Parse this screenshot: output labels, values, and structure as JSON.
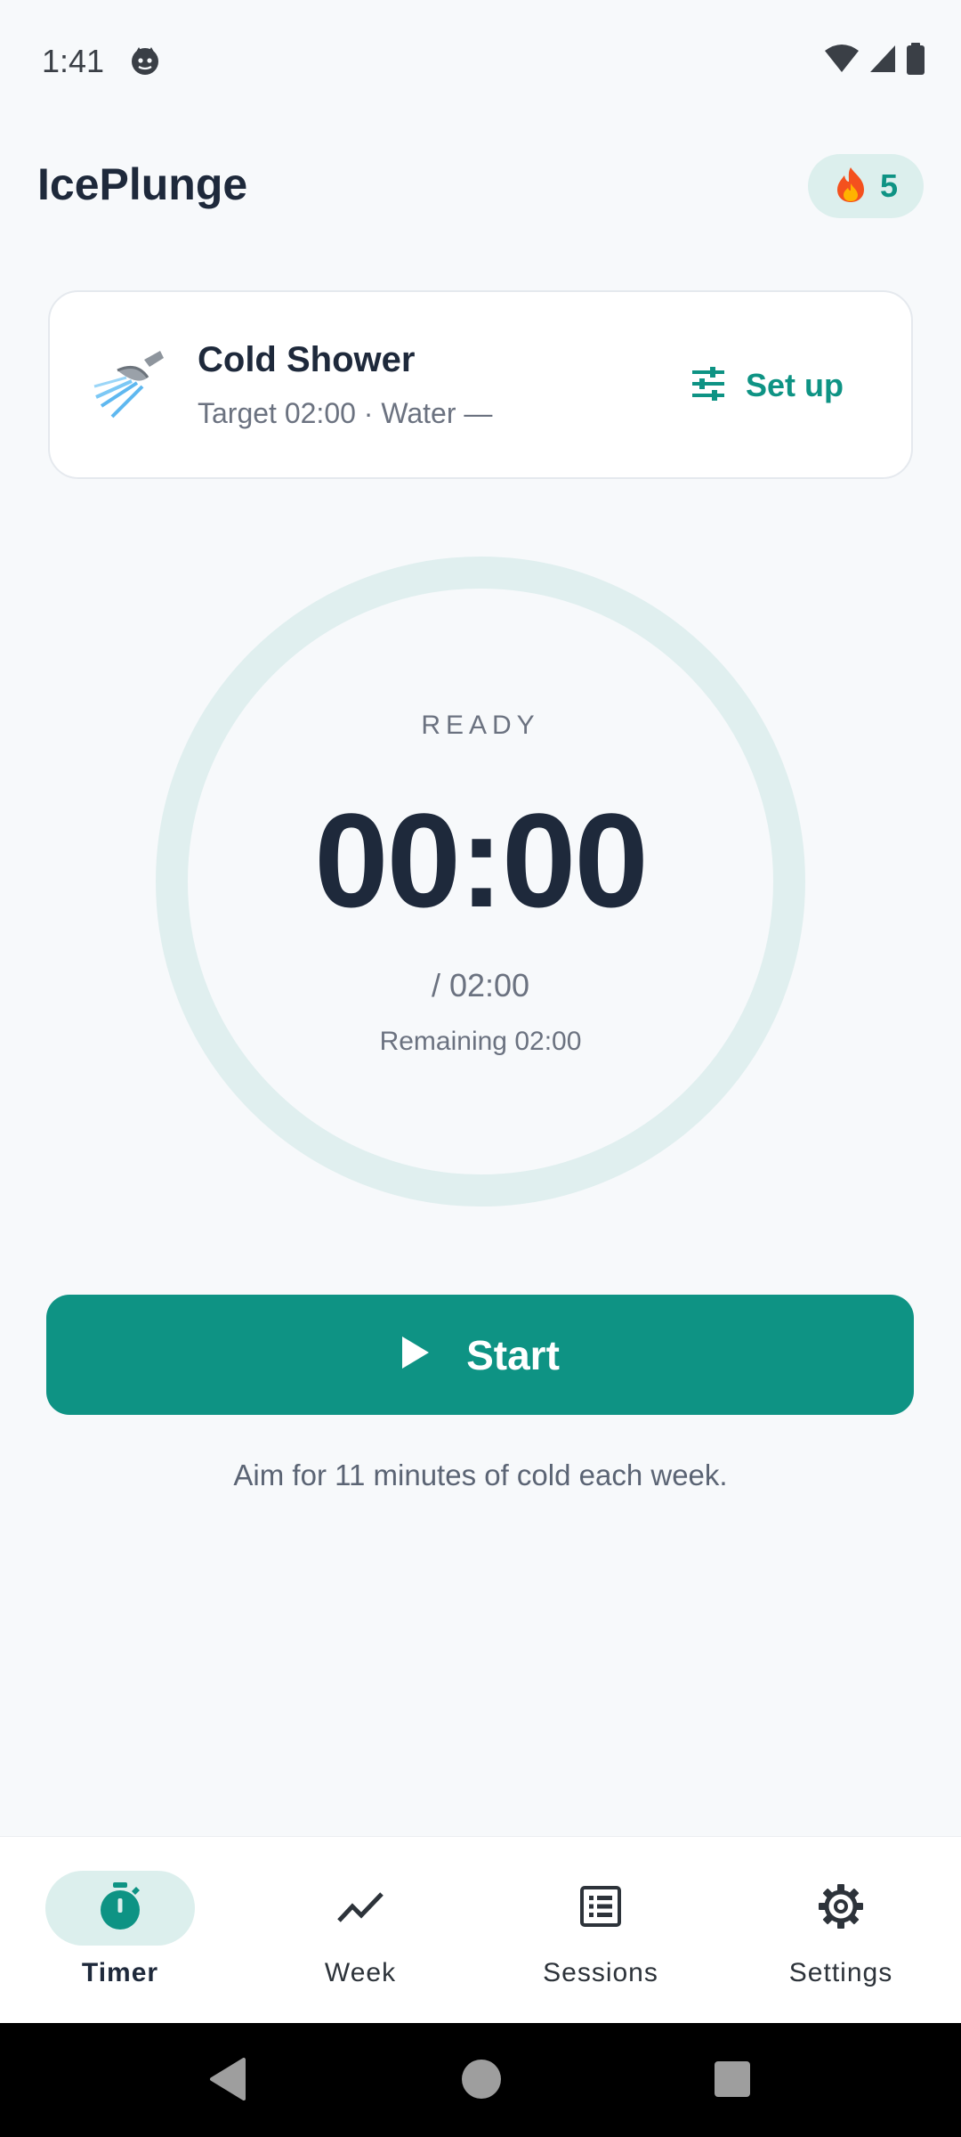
{
  "status_bar": {
    "time": "1:41"
  },
  "header": {
    "title": "IcePlunge",
    "streak_count": "5"
  },
  "preset_card": {
    "name": "Cold Shower",
    "subtitle": "Target 02:00 · Water —",
    "setup_label": "Set up"
  },
  "timer": {
    "state": "READY",
    "elapsed": "00:00",
    "target": "/ 02:00",
    "remaining": "Remaining 02:00",
    "progress_fraction": 0
  },
  "start_button": {
    "label": "Start"
  },
  "hint": "Aim for 11 minutes of cold each week.",
  "bottom_nav": {
    "items": [
      {
        "label": "Timer",
        "icon": "stopwatch-icon",
        "active": true
      },
      {
        "label": "Week",
        "icon": "trend-line-icon",
        "active": false
      },
      {
        "label": "Sessions",
        "icon": "list-icon",
        "active": false
      },
      {
        "label": "Settings",
        "icon": "gear-icon",
        "active": false
      }
    ]
  },
  "colors": {
    "accent": "#0e9384",
    "accent_soft": "#dcefed",
    "background": "#f7f9fb",
    "text_primary": "#1e293b",
    "text_secondary": "#6b7280"
  }
}
